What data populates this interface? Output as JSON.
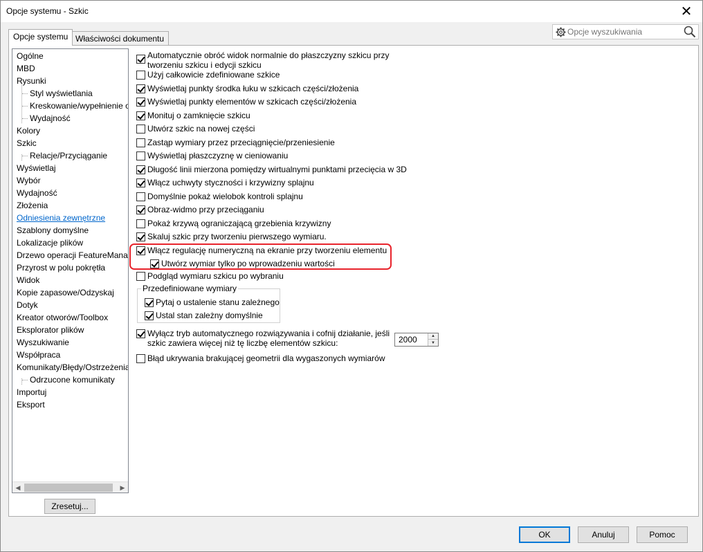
{
  "window": {
    "title": "Opcje systemu - Szkic",
    "close": "✕"
  },
  "tabs": [
    {
      "label": "Opcje systemu"
    },
    {
      "label": "Właściwości dokumentu"
    }
  ],
  "search": {
    "placeholder": "Opcje wyszukiwania"
  },
  "tree": {
    "items": [
      {
        "label": "Ogólne",
        "level": 0
      },
      {
        "label": "MBD",
        "level": 0
      },
      {
        "label": "Rysunki",
        "level": 0
      },
      {
        "label": "Styl wyświetlania",
        "level": 1
      },
      {
        "label": "Kreskowanie/wypełnienie obszaru",
        "level": 1
      },
      {
        "label": "Wydajność",
        "level": 1
      },
      {
        "label": "Kolory",
        "level": 0
      },
      {
        "label": "Szkic",
        "level": 0,
        "selected": true
      },
      {
        "label": "Relacje/Przyciąganie",
        "level": 1
      },
      {
        "label": "Wyświetlaj",
        "level": 0
      },
      {
        "label": "Wybór",
        "level": 0
      },
      {
        "label": "Wydajność",
        "level": 0
      },
      {
        "label": "Złożenia",
        "level": 0
      },
      {
        "label": "Odniesienia zewnętrzne",
        "level": 0,
        "link": true
      },
      {
        "label": "Szablony domyślne",
        "level": 0
      },
      {
        "label": "Lokalizacje plików",
        "level": 0
      },
      {
        "label": "Drzewo operacji FeatureManager",
        "level": 0
      },
      {
        "label": "Przyrost w polu pokrętła",
        "level": 0
      },
      {
        "label": "Widok",
        "level": 0
      },
      {
        "label": "Kopie zapasowe/Odzyskaj",
        "level": 0
      },
      {
        "label": "Dotyk",
        "level": 0
      },
      {
        "label": "Kreator otworów/Toolbox",
        "level": 0
      },
      {
        "label": "Eksplorator plików",
        "level": 0
      },
      {
        "label": "Wyszukiwanie",
        "level": 0
      },
      {
        "label": "Współpraca",
        "level": 0
      },
      {
        "label": "Komunikaty/Błędy/Ostrzeżenia",
        "level": 0
      },
      {
        "label": "Odrzucone komunikaty",
        "level": 1
      },
      {
        "label": "Importuj",
        "level": 0
      },
      {
        "label": "Eksport",
        "level": 0
      }
    ]
  },
  "reset_label": "Zresetuj...",
  "options": [
    {
      "label": "Automatycznie obróć widok normalnie do płaszczyzny szkicu przy",
      "label2": "tworzeniu szkicu i edycji szkicu",
      "checked": true
    },
    {
      "label": "Użyj całkowicie zdefiniowane szkice",
      "checked": false
    },
    {
      "label": "Wyświetlaj punkty środka łuku w szkicach części/złożenia",
      "checked": true
    },
    {
      "label": "Wyświetlaj punkty elementów w szkicach części/złożenia",
      "checked": true
    },
    {
      "label": "Monituj o zamknięcie szkicu",
      "checked": true
    },
    {
      "label": "Utwórz szkic na nowej części",
      "checked": false
    },
    {
      "label": "Zastąp wymiary przez przeciągnięcie/przeniesienie",
      "checked": false
    },
    {
      "label": "Wyświetlaj płaszczyznę w cieniowaniu",
      "checked": false
    },
    {
      "label": "Długość linii mierzona pomiędzy wirtualnymi punktami przecięcia w 3D",
      "checked": true
    },
    {
      "label": "Włącz uchwyty styczności i krzywizny splajnu",
      "checked": true
    },
    {
      "label": "Domyślnie pokaż wielobok kontroli splajnu",
      "checked": false
    },
    {
      "label": "Obraz-widmo przy przeciąganiu",
      "checked": true
    },
    {
      "label": "Pokaż krzywą ograniczającą grzebienia krzywizny",
      "checked": false
    },
    {
      "label": "Skaluj szkic przy tworzeniu pierwszego wymiaru.",
      "checked": true
    },
    {
      "label": "Włącz regulację numeryczną na ekranie przy tworzeniu elementu",
      "checked": true
    },
    {
      "label": "Utwórz wymiar tylko po wprowadzeniu wartości",
      "checked": true
    },
    {
      "label": "Podgląd wymiaru szkicu po wybraniu",
      "checked": false
    }
  ],
  "predefined": {
    "title": "Przedefiniowane wymiary",
    "items": [
      {
        "label": "Pytaj o ustalenie stanu zależnego",
        "checked": true
      },
      {
        "label": "Ustal stan zależny domyślnie",
        "checked": true
      }
    ]
  },
  "auto_solve": {
    "label": "Wyłącz tryb automatycznego rozwiązywania i cofnij działanie, jeśli",
    "label2": "szkic zawiera więcej niż tę liczbę elementów szkicu:",
    "checked": true,
    "value": "2000"
  },
  "hide_error": {
    "label": "Błąd ukrywania brakującej geometrii dla wygaszonych wymiarów",
    "checked": false
  },
  "buttons": {
    "ok": "OK",
    "cancel": "Anuluj",
    "help": "Pomoc"
  }
}
